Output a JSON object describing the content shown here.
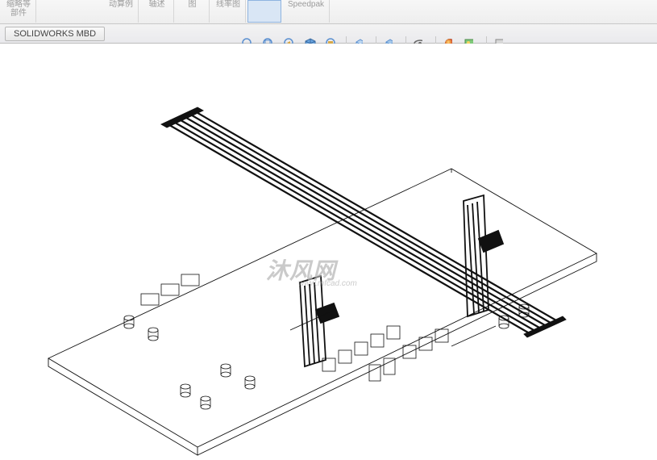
{
  "ribbon": {
    "group1_line1": "缩略等",
    "group1_line2": "部件",
    "group2": "动算例",
    "group3": "轴述",
    "group4": "图",
    "group5": "线率图",
    "group6": "Speedpak"
  },
  "tabs": {
    "mbd": "SOLIDWORKS MBD"
  },
  "hut": {
    "zoom_fit": "zoom-to-fit",
    "zoom_area": "zoom-to-area",
    "prev_view": "previous-view",
    "section": "section-view",
    "dyn_section": "dynamic-section",
    "view_orient": "view-orientation",
    "display_style": "display-style",
    "hide_show": "hide-show-items",
    "edit_appearance": "edit-appearance",
    "apply_scene": "apply-scene",
    "view_settings": "view-settings"
  },
  "watermark": {
    "main": "沐风网",
    "sub": "www.mfcad.com"
  },
  "colors": {
    "grey": "#9b9b9b",
    "icon_blue": "#4a8fd6",
    "icon_gold": "#d6a94a",
    "icon_green": "#6fb04a",
    "icon_red": "#d65a4a",
    "wire": "#111111"
  }
}
